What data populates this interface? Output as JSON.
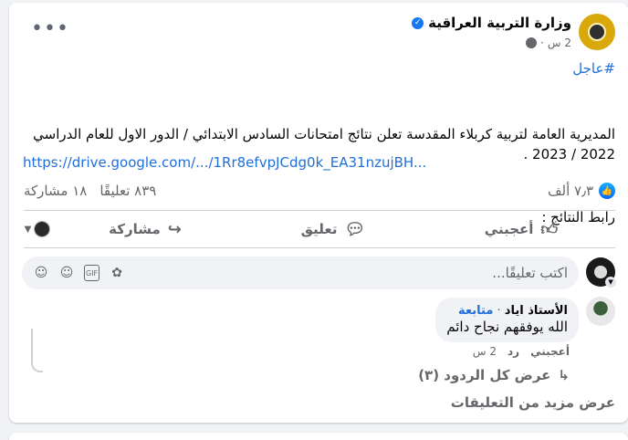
{
  "post": {
    "page_name": "وزارة التربية العراقية",
    "time": "2 س",
    "hashtag": "#عاجل",
    "text": "المديرية العامة لتربية كربلاء المقدسة تعلن نتائج امتحانات السادس الابتدائي / الدور الاول للعام الدراسي 2022 / 2023 .",
    "results_label": "رابط النتائج :",
    "link": "https://drive.google.com/.../1Rr8efvpJCdg0k_EA31nzujBH..."
  },
  "stats": {
    "reactions": "٧٫٣ ألف",
    "comments": "٨٣٩ تعليقًا",
    "shares": "١٨ مشاركة"
  },
  "actions": {
    "like": "أعجبني",
    "comment": "تعليق",
    "share": "مشاركة"
  },
  "composer": {
    "placeholder": "اكتب تعليقًا..."
  },
  "reply": {
    "author": "الأستاذ اياد",
    "follow": "متابعة",
    "text": "الله يوفقهم نجاح دائم",
    "like": "أعجبني",
    "reply": "رد",
    "time": "2 س"
  },
  "view_replies": "عرض كل الردود (٣)",
  "view_more_comments": "عرض مزيد من التعليقات",
  "colors": {
    "accent": "#216fdb",
    "muted": "#65676b",
    "bg": "#f0f2f5"
  },
  "icons": [
    "verified-icon",
    "globe-icon",
    "more-options-icon",
    "like-reaction-icon",
    "like-icon",
    "comment-icon",
    "share-icon",
    "sticker-icon",
    "gif-icon",
    "emoji-icon",
    "avatar-sticker-icon",
    "reply-arrow-icon"
  ]
}
